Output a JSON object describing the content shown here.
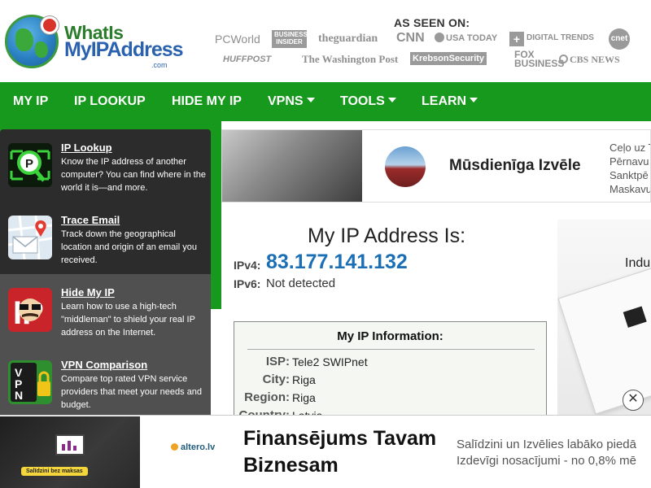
{
  "brand": {
    "line1": "WhatIs",
    "line2": "MyIPAddress",
    "line3": ".com"
  },
  "press": {
    "heading": "AS SEEN ON:",
    "row1": [
      "PCWorld",
      "BUSINESS INSIDER",
      "theguardian",
      "CNN",
      "USA TODAY",
      "DIGITAL TRENDS",
      "cnet"
    ],
    "row2": [
      "HUFFPOST",
      "The Washington Post",
      "KrebsonSecurity",
      "FOX BUSINESS",
      "CBS NEWS"
    ]
  },
  "nav": [
    {
      "label": "MY IP"
    },
    {
      "label": "IP LOOKUP"
    },
    {
      "label": "HIDE MY IP"
    },
    {
      "label": "VPNS"
    },
    {
      "label": "TOOLS"
    },
    {
      "label": "LEARN"
    }
  ],
  "menu": [
    {
      "title": "IP Lookup",
      "desc": "Know the IP address of another computer? You can find where in the world it is—and more.",
      "icon": "magnifier-ip-icon"
    },
    {
      "title": "Trace Email",
      "desc": "Track down the geographical location and origin of an email you received.",
      "icon": "map-envelope-icon"
    },
    {
      "title": "Hide My IP",
      "desc": "Learn how to use a high-tech \"middleman\" to shield your real IP address on the Internet.",
      "icon": "disguise-icon"
    },
    {
      "title": "VPN Comparison",
      "desc": "Compare top rated VPN service providers that meet your needs and budget.",
      "icon": "vpn-lock-icon"
    }
  ],
  "top_ad": {
    "title": "Mūsdienīga Izvēle",
    "lines": [
      "Ceļo uz T",
      "Pērnavu",
      "Sanktpē",
      "Maskavu"
    ]
  },
  "main": {
    "heading": "My IP Address Is:",
    "ipv4_label": "IPv4:",
    "ipv4_value": "83.177.141.132",
    "ipv6_label": "IPv6:",
    "ipv6_value": "Not detected"
  },
  "info": {
    "heading": "My IP Information:",
    "rows": [
      {
        "label": "ISP:",
        "value": "Tele2 SWIPnet"
      },
      {
        "label": "City:",
        "value": "Riga"
      },
      {
        "label": "Region:",
        "value": "Riga"
      },
      {
        "label": "Country:",
        "value": "Latvia"
      }
    ]
  },
  "side_ad": {
    "text": "Indu"
  },
  "close_ad": {
    "symbol": "✕"
  },
  "bottom_ad": {
    "brand": "altero.lv",
    "badge": "Salīdzini bez maksas",
    "title_line1": "Finansējums Tavam",
    "title_line2": "Biznesam",
    "text_line1": "Salīdzini un Izvēlies labāko piedā",
    "text_line2": "Izdevīgi nosacījumi - no 0,8% mē"
  },
  "colors": {
    "nav_green": "#17991d",
    "menu_dark": "#2c2c2c",
    "menu_alt": "#505050",
    "ip_blue": "#1c6fb4"
  }
}
